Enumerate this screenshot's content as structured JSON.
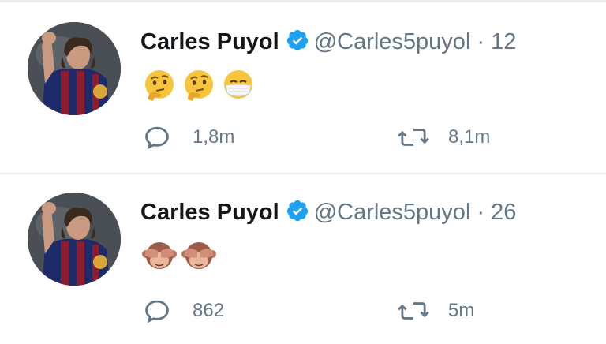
{
  "tweets": [
    {
      "name": "Carles Puyol",
      "handle": "@Carles5puyol",
      "separator": "·",
      "time": "12",
      "emojis": [
        "thinking-face",
        "thinking-face",
        "face-with-medical-mask"
      ],
      "replies": "1,8m",
      "retweets": "8,1m"
    },
    {
      "name": "Carles Puyol",
      "handle": "@Carles5puyol",
      "separator": "·",
      "time": "26",
      "emojis": [
        "see-no-evil-monkey",
        "see-no-evil-monkey"
      ],
      "replies": "862",
      "retweets": "5m"
    }
  ],
  "colors": {
    "verified": "#1da1f2",
    "muted": "#657786",
    "divider": "#e6ecf0"
  }
}
